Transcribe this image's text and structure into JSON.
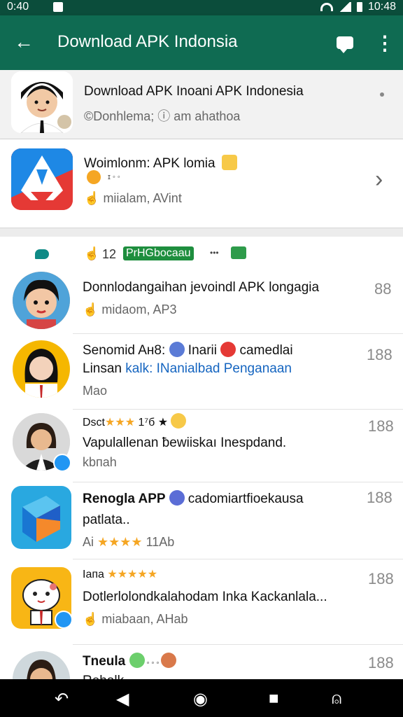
{
  "status": {
    "time": "0:40",
    "clock": "10:48"
  },
  "appbar": {
    "title": "Download APK Indonsia"
  },
  "top_card": {
    "title": "Download APK Inoani APK Indonesia",
    "subtitle": "©Donhlema; ⓘ am ahathoa"
  },
  "app_card": {
    "title": "Woimlonm: APK lomia",
    "small": "ɪ ◦ ◦",
    "subtitle": "miialam, AVint"
  },
  "section": {
    "count": "12",
    "tag": "PrHGbocaau",
    "dots": "•••"
  },
  "items": [
    {
      "line1": "Donnlodangaihan jevoindl APK longagia",
      "line2": "",
      "meta": "midaom, AP3",
      "num": "88"
    },
    {
      "line1": "Senomid Aн8: ",
      "line1b": " Inarii ",
      "line1c": " camedlai",
      "line2a": "Linsan ",
      "line2b": "kalk: INanialbad Penganaan",
      "meta": "Mao",
      "num": "188"
    },
    {
      "line1": "Dsct",
      "line1stars": "★★★",
      "line1b": " 1⁷б ★",
      "line2": "Vapulallenan ƀewiiskaı Inespdand.",
      "meta": "kbпаh",
      "num": "188"
    },
    {
      "line1": "Renogla APP ",
      "line1b": " cadomiartfioekausa",
      "line2": "patlata..",
      "meta_prefix": "Ai ",
      "meta_stars": "★★★★",
      "meta": "  11Ab",
      "num": "188"
    },
    {
      "line1": "Iaпа ",
      "line1stars": "★★★★★",
      "line2": "Dotlerlolondkalahodam Inka Kackanlala...",
      "meta": "miabaan, AHab",
      "num": "188"
    },
    {
      "line1": "Tneula ",
      "line1b": " ◦ ◦ ◦ ",
      "line2": "Rehalk",
      "meta": "",
      "num": "188"
    }
  ],
  "colors": {
    "appbar": "#0f6b52",
    "statusbar": "#0b4d3b",
    "tag": "#1e8e3e",
    "link": "#1565c0"
  }
}
